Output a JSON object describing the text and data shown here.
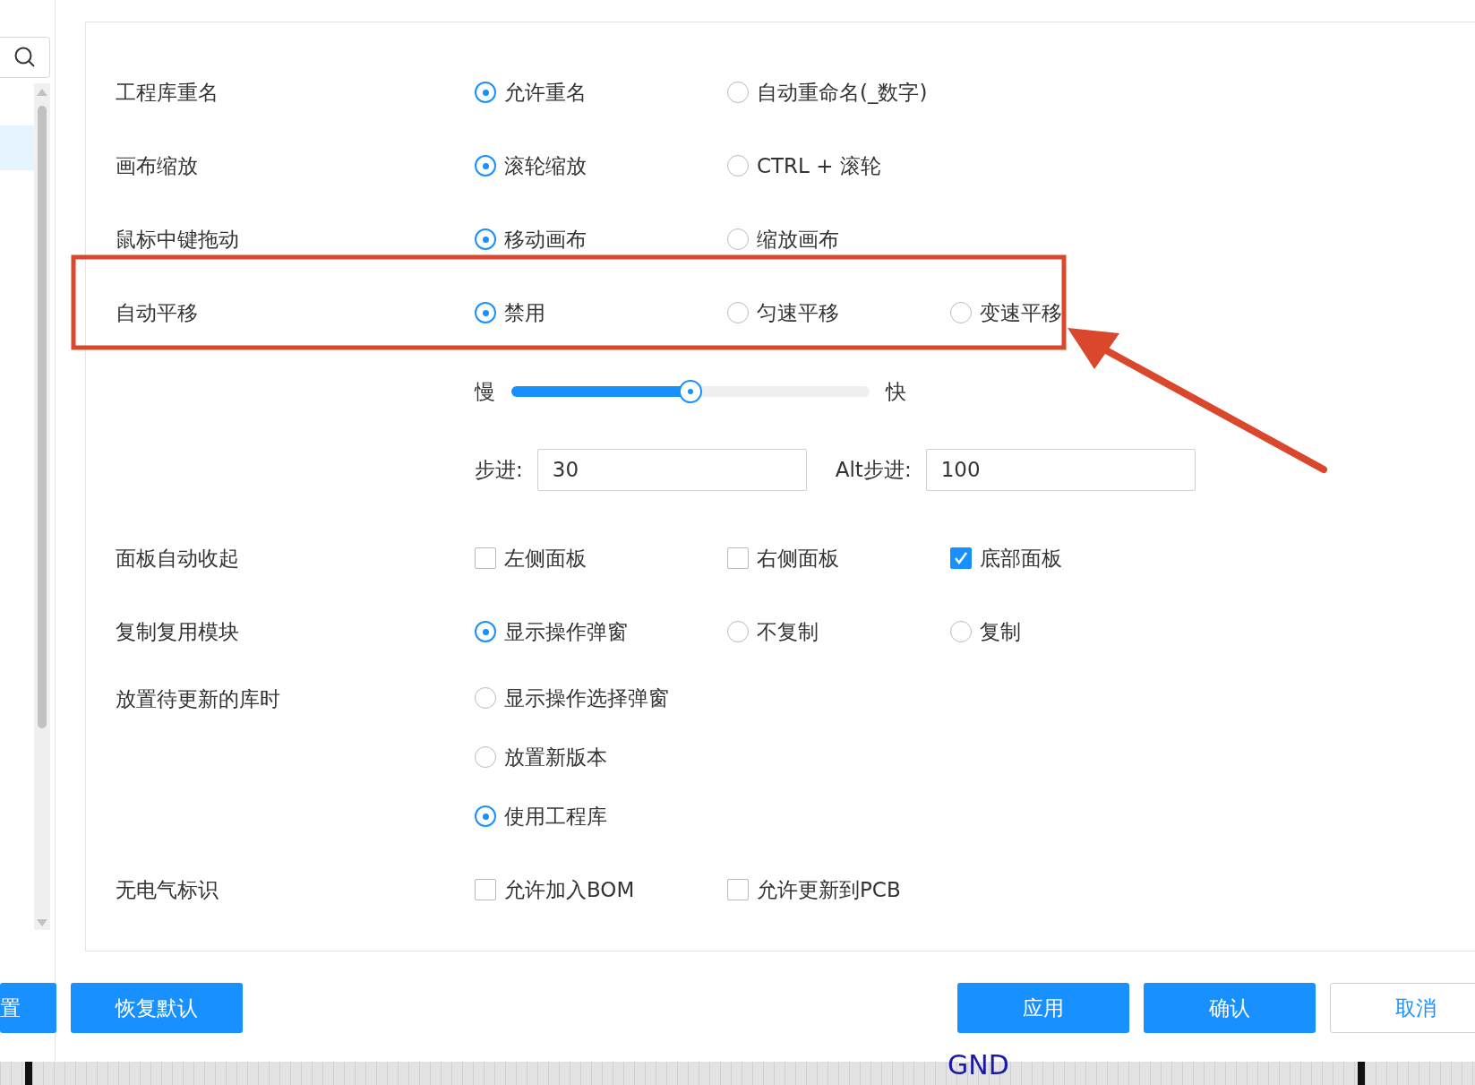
{
  "sidebar": {
    "items": [
      {
        "selected": true
      }
    ]
  },
  "settings": [
    {
      "label": "工程库重名",
      "kind": "radio",
      "options": [
        {
          "label": "允许重名",
          "selected": true
        },
        {
          "label": "自动重命名(_数字)",
          "selected": false
        }
      ]
    },
    {
      "label": "画布缩放",
      "kind": "radio",
      "options": [
        {
          "label": "滚轮缩放",
          "selected": true
        },
        {
          "label": "CTRL + 滚轮",
          "selected": false
        }
      ]
    },
    {
      "label": "鼠标中键拖动",
      "kind": "radio",
      "options": [
        {
          "label": "移动画布",
          "selected": true
        },
        {
          "label": "缩放画布",
          "selected": false
        }
      ]
    },
    {
      "label": "自动平移",
      "kind": "radio",
      "options": [
        {
          "label": "禁用",
          "selected": true
        },
        {
          "label": "匀速平移",
          "selected": false
        },
        {
          "label": "变速平移",
          "selected": false
        }
      ]
    },
    {
      "kind": "slider",
      "min_label": "慢",
      "max_label": "快",
      "level": 0.5
    },
    {
      "kind": "steps",
      "fields": [
        {
          "label": "步进:",
          "value": "30"
        },
        {
          "label": "Alt步进:",
          "value": "100"
        }
      ]
    },
    {
      "label": "面板自动收起",
      "kind": "checkbox",
      "options": [
        {
          "label": "左侧面板",
          "checked": false
        },
        {
          "label": "右侧面板",
          "checked": false
        },
        {
          "label": "底部面板",
          "checked": true
        }
      ]
    },
    {
      "label": "复制复用模块",
      "kind": "radio",
      "options": [
        {
          "label": "显示操作弹窗",
          "selected": true
        },
        {
          "label": "不复制",
          "selected": false
        },
        {
          "label": "复制",
          "selected": false
        }
      ]
    },
    {
      "label": "放置待更新的库时",
      "kind": "radio_stack",
      "options": [
        {
          "label": "显示操作选择弹窗",
          "selected": false
        },
        {
          "label": "放置新版本",
          "selected": false
        },
        {
          "label": "使用工程库",
          "selected": true
        }
      ]
    },
    {
      "label": "无电气标识",
      "kind": "checkbox",
      "options": [
        {
          "label": "允许加入BOM",
          "checked": false
        },
        {
          "label": "允许更新到PCB",
          "checked": false
        }
      ]
    }
  ],
  "annotation": {
    "kind": "box_arrow"
  },
  "footer": {
    "left_buttons": [
      {
        "label": "置",
        "kind": "primary"
      },
      {
        "label": "恢复默认",
        "kind": "primary"
      }
    ],
    "right_buttons": [
      {
        "label": "应用",
        "kind": "primary"
      },
      {
        "label": "确认",
        "kind": "primary"
      },
      {
        "label": "取消",
        "kind": "default"
      }
    ]
  },
  "canvas": {
    "net_label": "GND"
  }
}
